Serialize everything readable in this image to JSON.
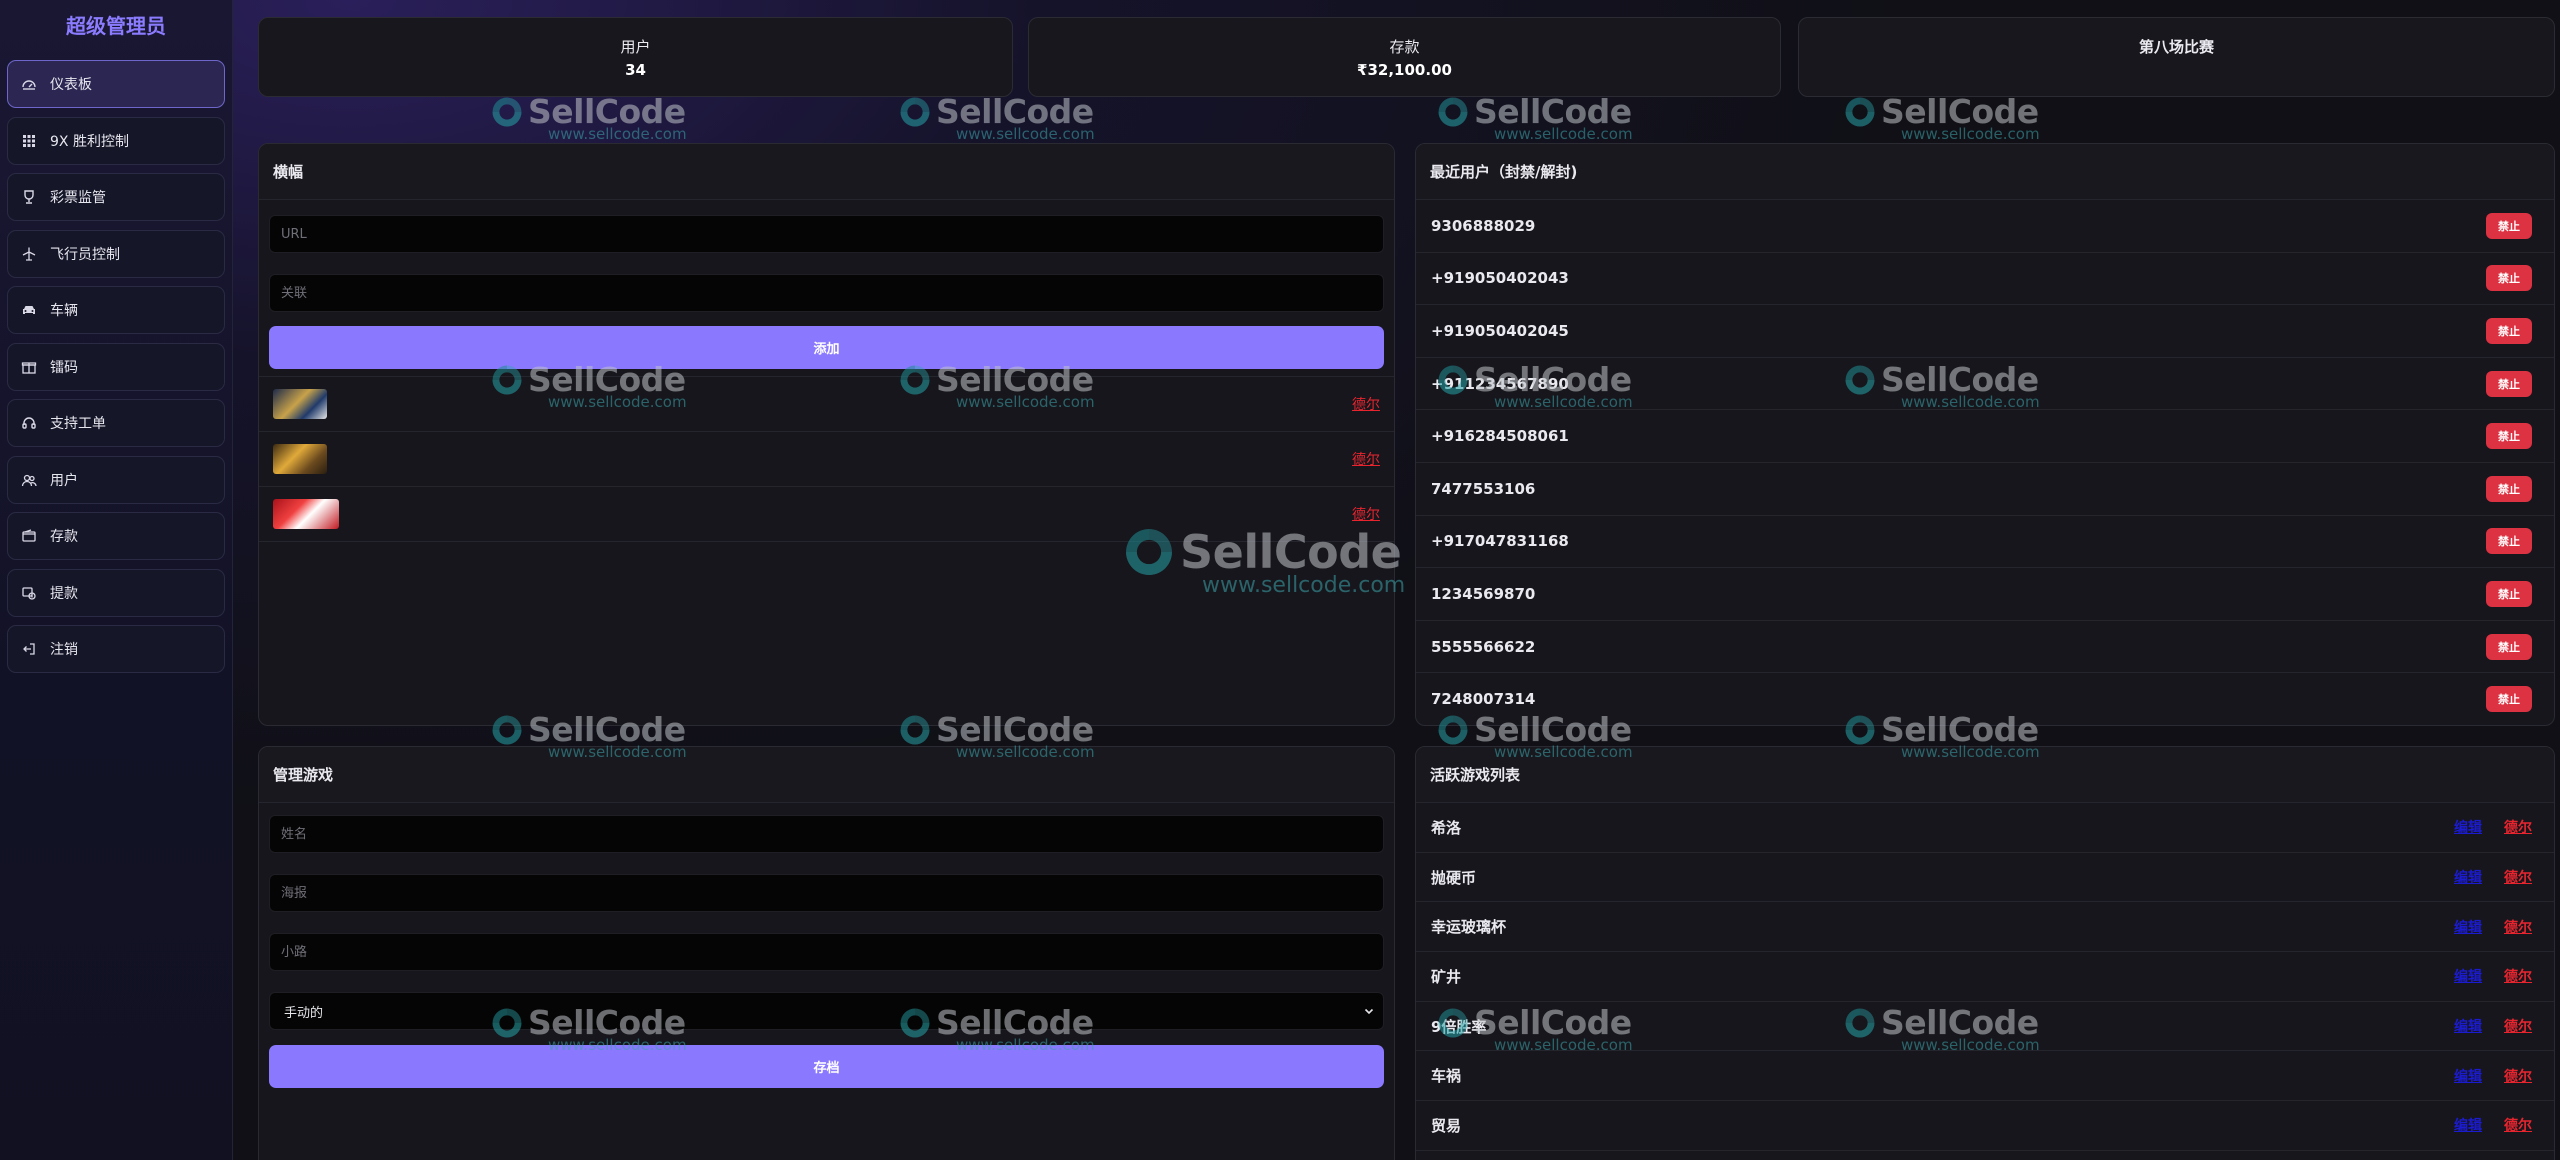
{
  "brand": "超级管理员",
  "sidebar": {
    "items": [
      {
        "label": "仪表板",
        "icon": "dashboard-icon"
      },
      {
        "label": "9X 胜利控制",
        "icon": "grid-icon"
      },
      {
        "label": "彩票监管",
        "icon": "trophy-icon"
      },
      {
        "label": "飞行员控制",
        "icon": "plane-icon"
      },
      {
        "label": "车辆",
        "icon": "car-icon"
      },
      {
        "label": "镭码",
        "icon": "gift-icon"
      },
      {
        "label": "支持工单",
        "icon": "headset-icon"
      },
      {
        "label": "用户",
        "icon": "users-icon"
      },
      {
        "label": "存款",
        "icon": "wallet-icon"
      },
      {
        "label": "提款",
        "icon": "withdraw-icon"
      },
      {
        "label": "注销",
        "icon": "logout-icon"
      }
    ]
  },
  "stats": {
    "users": {
      "label": "用户",
      "value": "34"
    },
    "deposits": {
      "label": "存款",
      "value": "₹32,100.00"
    },
    "match": {
      "label": "第八场比赛"
    }
  },
  "banner_panel": {
    "title": "横幅",
    "url_placeholder": "URL",
    "link_placeholder": "关联",
    "add_label": "添加",
    "rows": [
      {
        "delete_label": "德尔"
      },
      {
        "delete_label": "德尔"
      },
      {
        "delete_label": "德尔"
      }
    ]
  },
  "recent_users": {
    "title": "最近用户（封禁/解封)",
    "ban_label": "禁止",
    "users": [
      "9306888029",
      "+919050402043",
      "+919050402045",
      "+911234567890",
      "+916284508061",
      "7477553106",
      "+917047831168",
      "1234569870",
      "5555566622",
      "7248007314"
    ]
  },
  "manage_games": {
    "title": "管理游戏",
    "name_placeholder": "姓名",
    "poster_placeholder": "海报",
    "route_placeholder": "小路",
    "mode_value": "手动的",
    "save_label": "存档"
  },
  "active_games": {
    "title": "活跃游戏列表",
    "edit_label": "编辑",
    "delete_label": "德尔",
    "games": [
      "希洛",
      "抛硬币",
      "幸运玻璃杯",
      "矿井",
      "9倍胜率",
      "车祸",
      "贸易"
    ]
  },
  "watermark": {
    "text": "SellCode",
    "url": "www.sellcode.com"
  },
  "colors": {
    "accent": "#8a78ff",
    "danger": "#dc3242",
    "link_red": "#e8252f",
    "link_blue": "#1b1bd0"
  }
}
